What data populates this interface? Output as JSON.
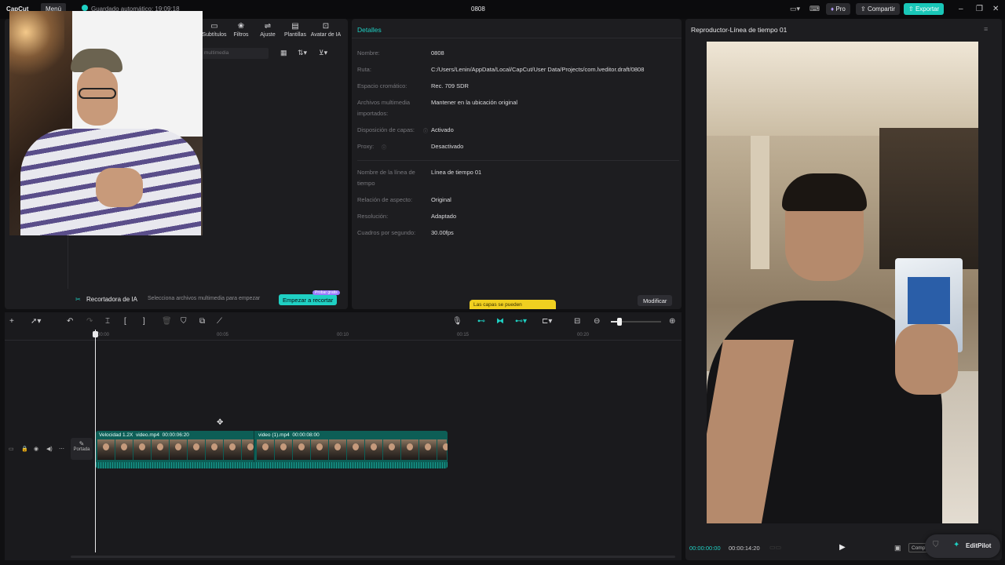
{
  "titlebar": {
    "app_name": "CapCut",
    "menu_label": "Menú",
    "autosave": "Guardado automático: 19:09:18",
    "project_name": "0808",
    "pro_label": "Pro",
    "share_label": "Compartir",
    "export_label": "Exportar"
  },
  "media_panel": {
    "tabs": [
      {
        "label": "Subtítulos",
        "icon": "subtitles-icon"
      },
      {
        "label": "Filtros",
        "icon": "filters-icon"
      },
      {
        "label": "Ajuste",
        "icon": "adjust-icon"
      },
      {
        "label": "Plantillas",
        "icon": "templates-icon"
      },
      {
        "label": "Avatar de IA",
        "icon": "avatar-icon"
      }
    ],
    "search_placeholder": "multimedia",
    "ai_cutter_label": "Recortadora de IA",
    "ai_cutter_hint": "Selecciona archivos multimedia para empezar",
    "ai_cutter_button": "Empezar a recortar",
    "ai_cutter_badge": "Probar gratis"
  },
  "details": {
    "title": "Detalles",
    "rows": [
      {
        "label": "Nombre:",
        "value": "0808"
      },
      {
        "label": "Ruta:",
        "value": "C:/Users/Lenin/AppData/Local/CapCut/User Data/Projects/com.lveditor.draft/0808"
      },
      {
        "label": "Espacio cromático:",
        "value": "Rec. 709 SDR"
      },
      {
        "label": "Archivos multimedia importados:",
        "value": "Mantener en la ubicación original"
      },
      {
        "label": "Disposición de capas:",
        "value": "Activado"
      },
      {
        "label": "Proxy:",
        "value": "Desactivado"
      },
      {
        "label": "Nombre de la línea de tiempo",
        "value": "Línea de tiempo 01"
      },
      {
        "label": "Relación de aspecto:",
        "value": "Original"
      },
      {
        "label": "Resolución:",
        "value": "Adaptado"
      },
      {
        "label": "Cuadros por segundo:",
        "value": "30.00fps"
      }
    ],
    "tooltip": "Las capas se pueden",
    "modify_button": "Modificar"
  },
  "player": {
    "title": "Reproductor-Línea de tiempo 01",
    "current_time": "00:00:00:00",
    "total_time": "00:00:14:20",
    "editpilot_label": "EditPilot",
    "compare_label": "Comp"
  },
  "timeline": {
    "ruler": [
      "00:00",
      "00:05",
      "00:10",
      "00:15",
      "00:20"
    ],
    "cover_label": "Portada",
    "clip1_label": "Velocidad 1.2X  video.mp4  00:00:06:20",
    "clip2_label": "video (1).mp4  00:00:08:00"
  },
  "colors": {
    "accent": "#1fd0c3",
    "export_bg": "#19c7b8",
    "track": "#0d5e56",
    "tooltip_bg": "#f0d020"
  }
}
